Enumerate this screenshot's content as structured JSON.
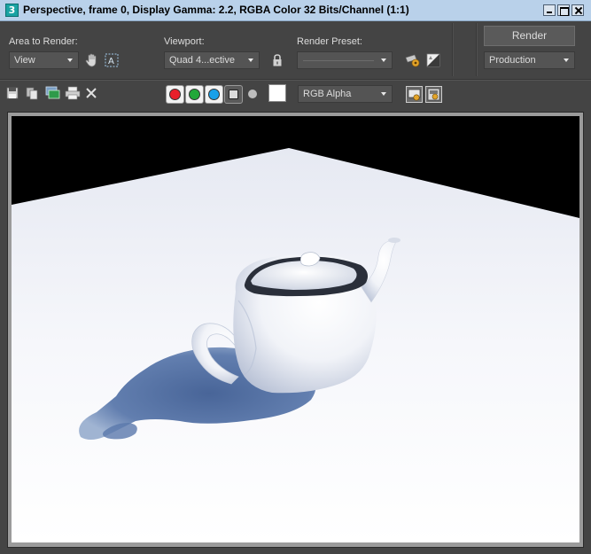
{
  "window": {
    "title": "Perspective, frame 0, Display Gamma: 2.2, RGBA Color 32 Bits/Channel (1:1)",
    "app_icon_label": "3"
  },
  "area_to_render": {
    "label": "Area to Render:",
    "value": "View"
  },
  "viewport_select": {
    "label": "Viewport:",
    "value": "Quad 4...ective"
  },
  "render_preset": {
    "label": "Render Preset:",
    "value": ""
  },
  "render": {
    "button_label": "Render",
    "mode_value": "Production"
  },
  "toolbar": {
    "channel_display_value": "RGB Alpha",
    "channels": [
      {
        "name": "red",
        "color": "#e8202a"
      },
      {
        "name": "green",
        "color": "#22a83a"
      },
      {
        "name": "blue",
        "color": "#1aa0e8"
      }
    ],
    "swatch_color": "#ffffff"
  }
}
